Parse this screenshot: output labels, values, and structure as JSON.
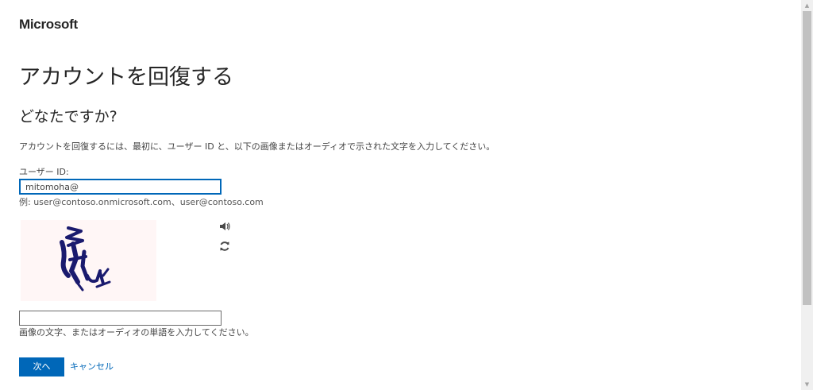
{
  "brand": {
    "logo_text": "Microsoft"
  },
  "page": {
    "title": "アカウントを回復する",
    "subtitle": "どなたですか?",
    "instructions": "アカウントを回復するには、最初に、ユーザー ID と、以下の画像またはオーディオで示された文字を入力してください。"
  },
  "form": {
    "userid_label": "ユーザー ID:",
    "userid_value": "mitomoha@",
    "userid_example": "例: user@contoso.onmicrosoft.com、user@contoso.com",
    "captcha_value": "",
    "captcha_help": "画像の文字、またはオーディオの単語を入力してください。",
    "audio_icon": "speaker-icon",
    "refresh_icon": "refresh-icon"
  },
  "actions": {
    "next_label": "次へ",
    "cancel_label": "キャンセル"
  },
  "colors": {
    "accent": "#0067b8",
    "captcha_background": "#fff6f6",
    "captcha_ink": "#1a1a6e"
  }
}
